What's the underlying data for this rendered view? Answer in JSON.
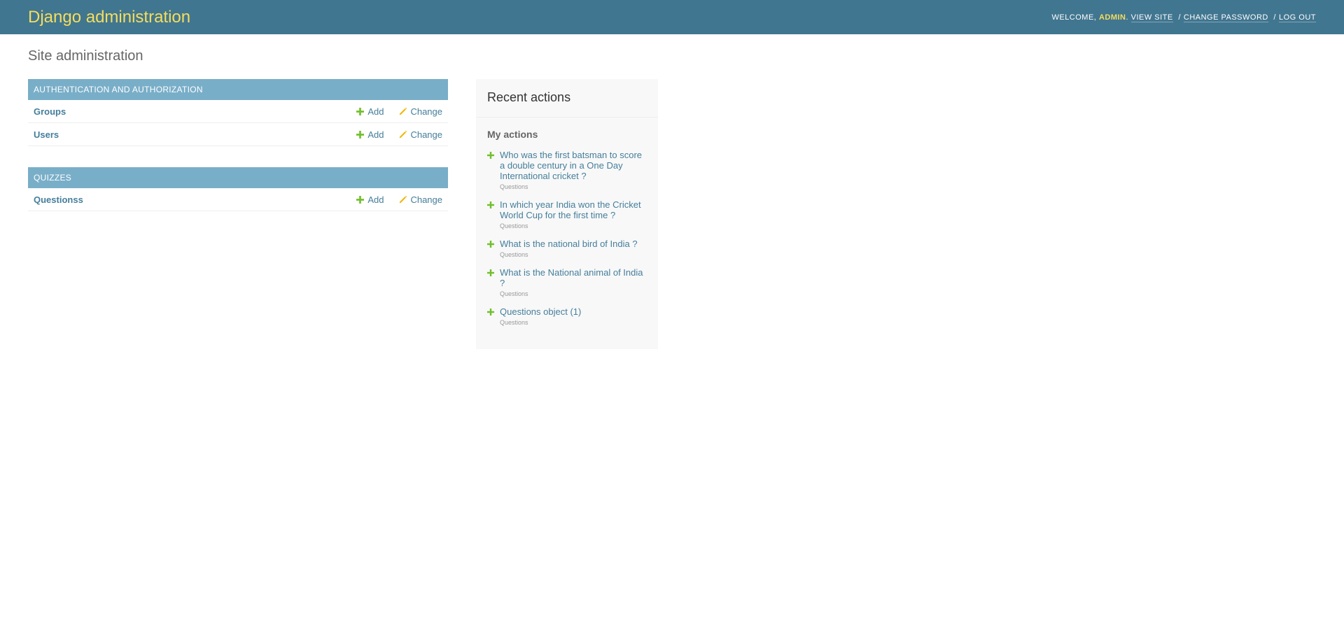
{
  "header": {
    "branding": "Django administration",
    "user_tools": {
      "welcome": "Welcome,",
      "username": "admin",
      "period": ".",
      "view_site": "View site",
      "separator": "/",
      "change_password": "Change password",
      "log_out": "Log out"
    }
  },
  "page": {
    "title": "Site administration"
  },
  "apps": [
    {
      "name": "Authentication and Authorization",
      "models": [
        {
          "name": "Groups",
          "add": "Add",
          "change": "Change"
        },
        {
          "name": "Users",
          "add": "Add",
          "change": "Change"
        }
      ]
    },
    {
      "name": "Quizzes",
      "models": [
        {
          "name": "Questionss",
          "add": "Add",
          "change": "Change"
        }
      ]
    }
  ],
  "recent_actions": {
    "title": "Recent actions",
    "my_actions_title": "My actions",
    "items": [
      {
        "label": "Who was the first batsman to score a double century in a One Day International cricket ?",
        "content_type": "Questions"
      },
      {
        "label": "In which year India won the Cricket World Cup for the first time ?",
        "content_type": "Questions"
      },
      {
        "label": "What is the national bird of India ?",
        "content_type": "Questions"
      },
      {
        "label": "What is the National animal of India ?",
        "content_type": "Questions"
      },
      {
        "label": "Questions object (1)",
        "content_type": "Questions"
      }
    ]
  },
  "colors": {
    "header_bg": "#417690",
    "branding": "#f5dd5d",
    "caption_bg": "#79aec8",
    "link": "#447e9b",
    "add_icon": "#70bf2b",
    "change_icon": "#efb80b"
  },
  "icons": {
    "add": "plus-icon",
    "change": "pencil-icon"
  }
}
